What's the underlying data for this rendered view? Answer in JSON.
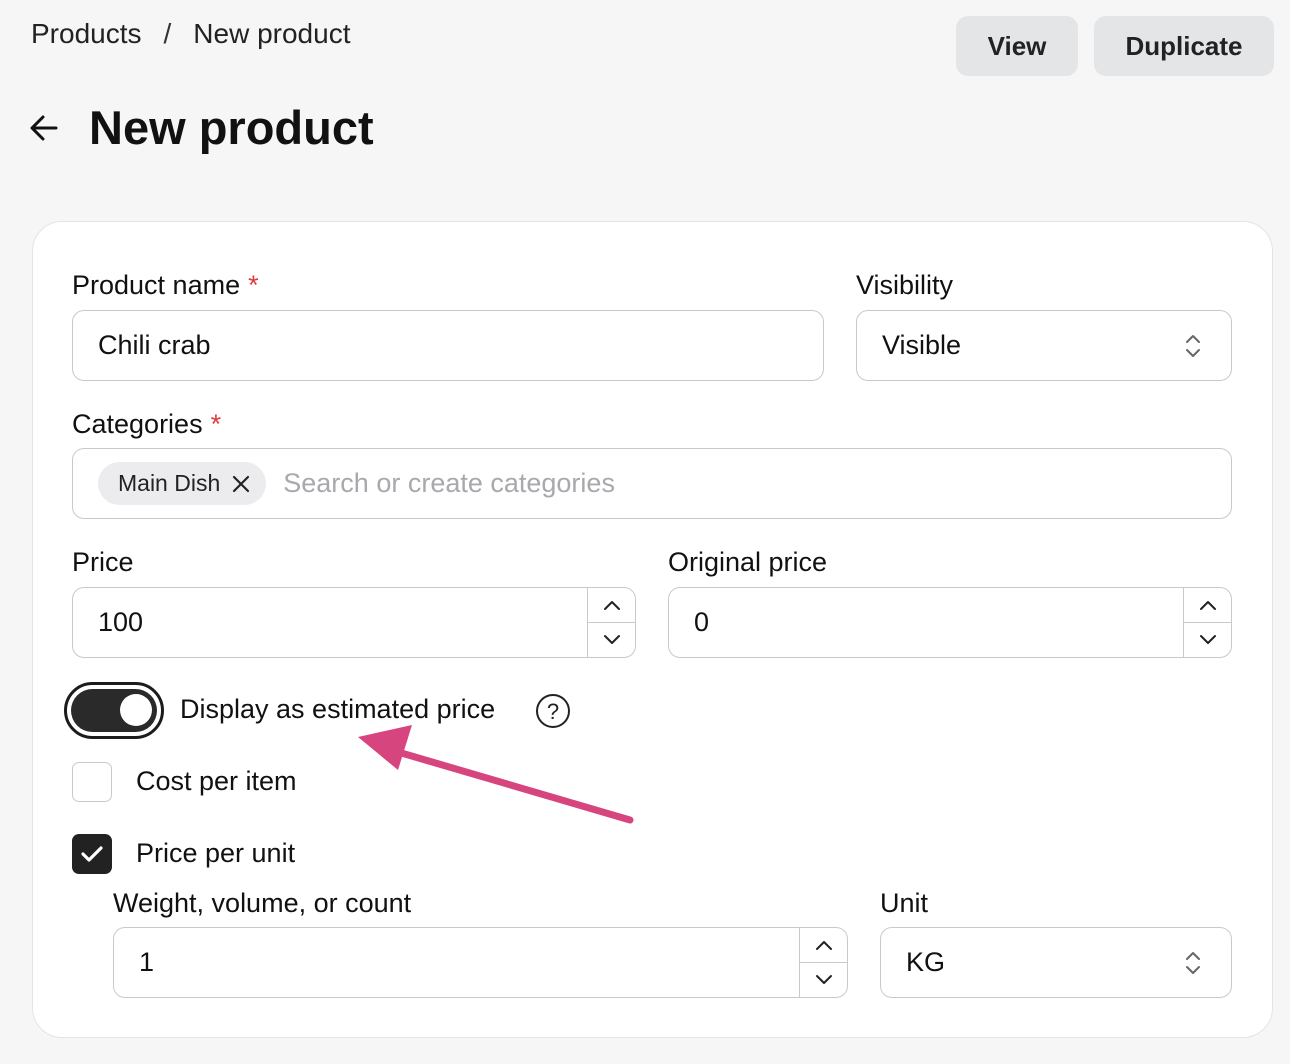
{
  "breadcrumb": {
    "parent": "Products",
    "separator": "/",
    "current": "New product"
  },
  "actions": {
    "view": "View",
    "duplicate": "Duplicate"
  },
  "page": {
    "title": "New product"
  },
  "form": {
    "product_name": {
      "label": "Product name",
      "required": "*",
      "value": "Chili crab"
    },
    "visibility": {
      "label": "Visibility",
      "value": "Visible"
    },
    "categories": {
      "label": "Categories",
      "required": "*",
      "chip": "Main Dish",
      "placeholder": "Search or create categories"
    },
    "price": {
      "label": "Price",
      "value": "100"
    },
    "original_price": {
      "label": "Original price",
      "value": "0"
    },
    "estimated_price": {
      "label": "Display as estimated price",
      "enabled": true
    },
    "cost_per_item": {
      "label": "Cost per item",
      "checked": false
    },
    "price_per_unit": {
      "label": "Price per unit",
      "checked": true
    },
    "weight": {
      "label": "Weight, volume, or count",
      "value": "1"
    },
    "unit": {
      "label": "Unit",
      "value": "KG"
    }
  },
  "colors": {
    "required": "#e03a3a",
    "annotation_arrow": "#d6457e",
    "toggle_on": "#2a2a2a"
  }
}
